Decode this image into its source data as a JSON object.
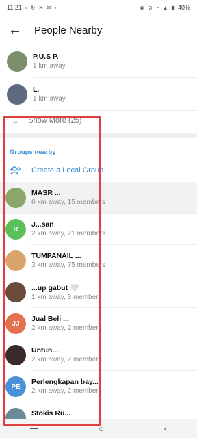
{
  "status_bar": {
    "time": "11:21",
    "battery": "40%"
  },
  "app_bar": {
    "title": "People Nearby"
  },
  "people": [
    {
      "name": "P.U.S P.",
      "distance": "1 km away",
      "color": "#7a8f6a"
    },
    {
      "name": "L.",
      "distance": "1 km away",
      "color": "#5e6a80"
    }
  ],
  "show_more": {
    "label": "Show More (25)"
  },
  "groups_header": "Groups nearby",
  "create_group": {
    "label": "Create a Local Group"
  },
  "groups": [
    {
      "name": "MASR ...",
      "meta": "6 km away, 15 members",
      "initials": "",
      "color": "#8aa66a"
    },
    {
      "name": "J...san",
      "meta": "2 km away, 21 members",
      "initials": "R",
      "color": "#5bbf5b"
    },
    {
      "name": "TUMPANAIL ...",
      "meta": "3 km away, 75 members",
      "initials": "",
      "color": "#d9a36a"
    },
    {
      "name": "...up gabut 🤍",
      "meta": "1 km away, 3 members",
      "initials": "",
      "color": "#6a4a3a"
    },
    {
      "name": "Jual Beli ...",
      "meta": "2 km away, 2 members",
      "initials": "JJ",
      "color": "#e4704f"
    },
    {
      "name": "Untun...",
      "meta": "2 km away, 2 members",
      "initials": "",
      "color": "#3a2a2a"
    },
    {
      "name": "Perlengkapan bay...",
      "meta": "2 km away, 2 members",
      "initials": "PE",
      "color": "#4a90d9"
    },
    {
      "name": "Stokis Ru...",
      "meta": "2 km away",
      "initials": "",
      "color": "#6a8a9a"
    }
  ]
}
